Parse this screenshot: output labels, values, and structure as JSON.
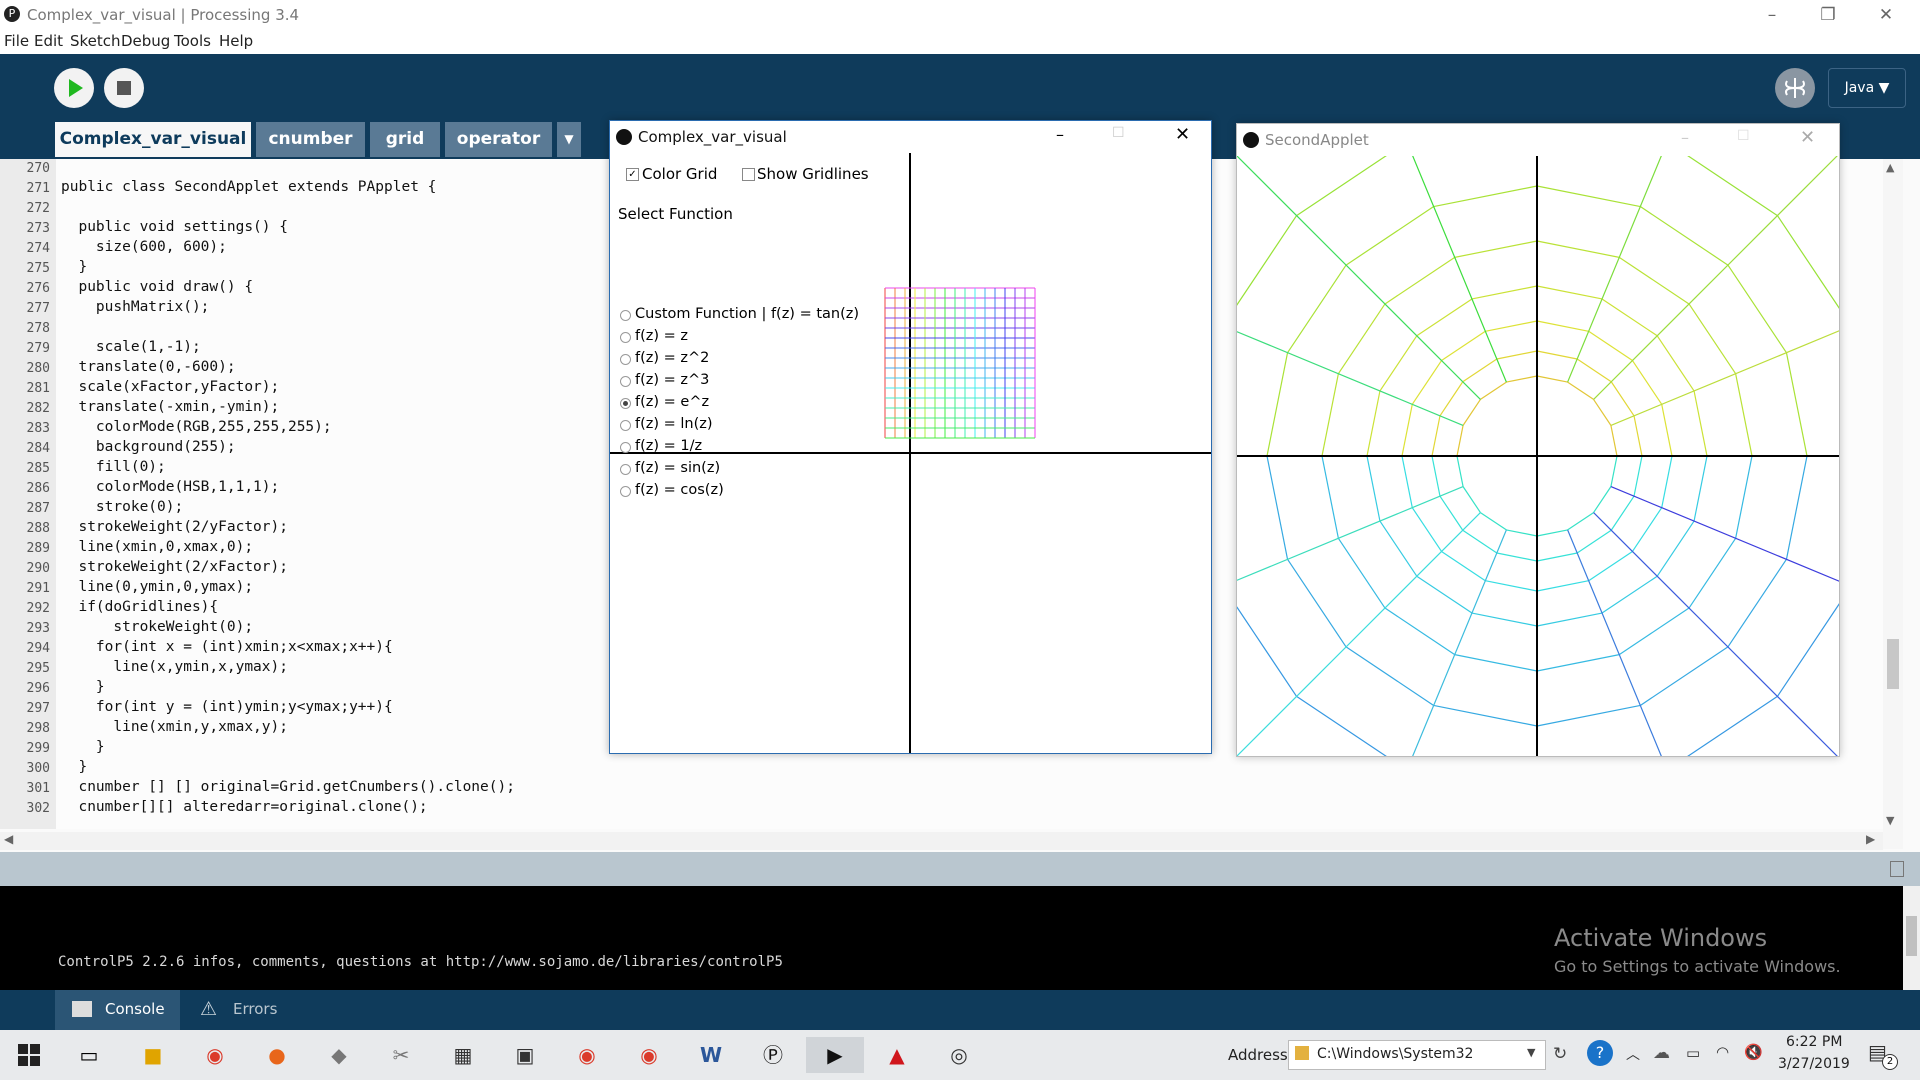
{
  "window": {
    "title": "Complex_var_visual | Processing 3.4"
  },
  "menu": [
    "File",
    "Edit",
    "Sketch",
    "Debug",
    "Tools",
    "Help"
  ],
  "toolbar": {
    "mode": "Java ▼"
  },
  "tabs": [
    {
      "label": "Complex_var_visual"
    },
    {
      "label": "cnumber"
    },
    {
      "label": "grid"
    },
    {
      "label": "operator"
    }
  ],
  "editor": {
    "lines": [
      {
        "n": "270",
        "code": ""
      },
      {
        "n": "271",
        "code": "public class SecondApplet extends PApplet {"
      },
      {
        "n": "272",
        "code": ""
      },
      {
        "n": "273",
        "code": "  public void settings() {"
      },
      {
        "n": "274",
        "code": "    size(600, 600);"
      },
      {
        "n": "275",
        "code": "  }"
      },
      {
        "n": "276",
        "code": "  public void draw() {"
      },
      {
        "n": "277",
        "code": "    pushMatrix();"
      },
      {
        "n": "278",
        "code": ""
      },
      {
        "n": "279",
        "code": "    scale(1,-1);"
      },
      {
        "n": "280",
        "code": "  translate(0,-600);"
      },
      {
        "n": "281",
        "code": "  scale(xFactor,yFactor);"
      },
      {
        "n": "282",
        "code": "  translate(-xmin,-ymin);"
      },
      {
        "n": "283",
        "code": "    colorMode(RGB,255,255,255);"
      },
      {
        "n": "284",
        "code": "    background(255);"
      },
      {
        "n": "285",
        "code": "    fill(0);"
      },
      {
        "n": "286",
        "code": "    colorMode(HSB,1,1,1);"
      },
      {
        "n": "287",
        "code": "    stroke(0);"
      },
      {
        "n": "288",
        "code": "  strokeWeight(2/yFactor);"
      },
      {
        "n": "289",
        "code": "  line(xmin,0,xmax,0);"
      },
      {
        "n": "290",
        "code": "  strokeWeight(2/xFactor);"
      },
      {
        "n": "291",
        "code": "  line(0,ymin,0,ymax);"
      },
      {
        "n": "292",
        "code": "  if(doGridlines){"
      },
      {
        "n": "293",
        "code": "      strokeWeight(0);"
      },
      {
        "n": "294",
        "code": "    for(int x = (int)xmin;x<xmax;x++){"
      },
      {
        "n": "295",
        "code": "      line(x,ymin,x,ymax);"
      },
      {
        "n": "296",
        "code": "    }"
      },
      {
        "n": "297",
        "code": "    for(int y = (int)ymin;y<ymax;y++){"
      },
      {
        "n": "298",
        "code": "      line(xmin,y,xmax,y);"
      },
      {
        "n": "299",
        "code": "    }"
      },
      {
        "n": "300",
        "code": "  }"
      },
      {
        "n": "301",
        "code": "  cnumber [] [] original=Grid.getCnumbers().clone();"
      },
      {
        "n": "302",
        "code": "  cnumber[][] alteredarr=original.clone();"
      }
    ]
  },
  "console": {
    "message": "ControlP5 2.2.6 infos, comments, questions at http://www.sojamo.de/libraries/controlP5",
    "watermark_title": "Activate Windows",
    "watermark_sub": "Go to Settings to activate Windows."
  },
  "console_tabs": {
    "console": "Console",
    "errors": "Errors"
  },
  "applet1": {
    "title": "Complex_var_visual",
    "color_grid": "Color Grid",
    "show_gridlines": "Show Gridlines",
    "select_function": "Select Function",
    "functions": [
      "Custom Function | f(z) = tan(z)",
      "f(z) = z",
      "f(z) = z^2",
      "f(z) = z^3",
      "f(z) = e^z",
      "f(z) = ln(z)",
      "f(z) = 1/z",
      "f(z) = sin(z)",
      "f(z) = cos(z)"
    ],
    "selected_function": "f(z) = e^z",
    "color_grid_checked": true,
    "show_gridlines_checked": false
  },
  "applet2": {
    "title": "SecondApplet"
  },
  "taskbar": {
    "address_label": "Address",
    "address_value": "C:\\Windows\\System32",
    "time": "6:22 PM",
    "date": "3/27/2019",
    "notifications": "2"
  }
}
